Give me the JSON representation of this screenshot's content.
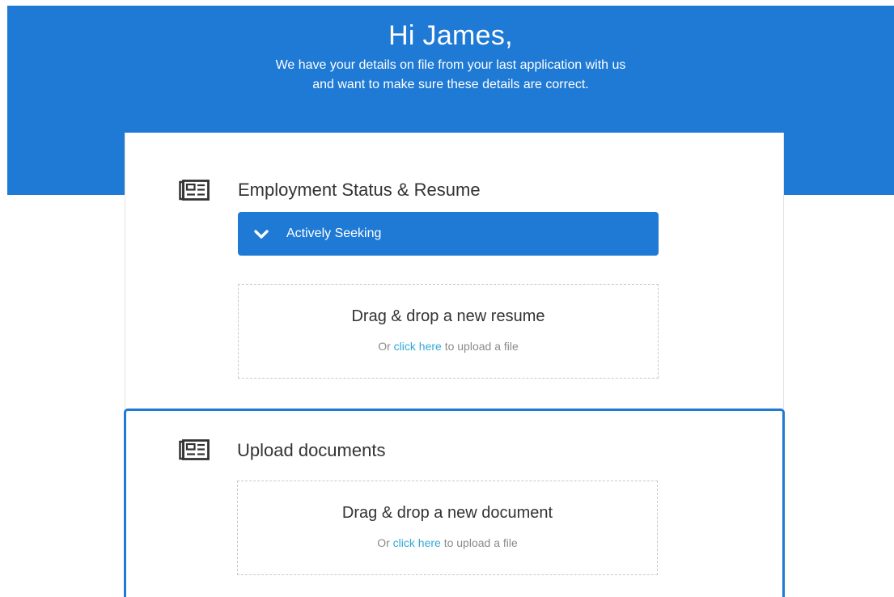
{
  "header": {
    "greeting": "Hi James,",
    "subtitle_line1": "We have your details on file from your last application with us",
    "subtitle_line2": "and want to make sure these details are correct."
  },
  "employment": {
    "title": "Employment Status & Resume",
    "icon": "newspaper-icon",
    "status_dropdown": {
      "selected": "Actively Seeking",
      "icon": "chevron-down-icon"
    },
    "resume_dropzone": {
      "title": "Drag & drop a new resume",
      "prefix": "Or",
      "link": "click here",
      "suffix": "to upload a file"
    }
  },
  "documents": {
    "title": "Upload documents",
    "icon": "newspaper-icon",
    "document_dropzone": {
      "title": "Drag & drop a new document",
      "prefix": "Or",
      "link": "click here",
      "suffix": "to upload a file"
    }
  },
  "colors": {
    "primary": "#1f7ad5",
    "link": "#31a8d8",
    "muted_text": "#8a8a8a",
    "dashed_border": "#c9c9c9"
  }
}
